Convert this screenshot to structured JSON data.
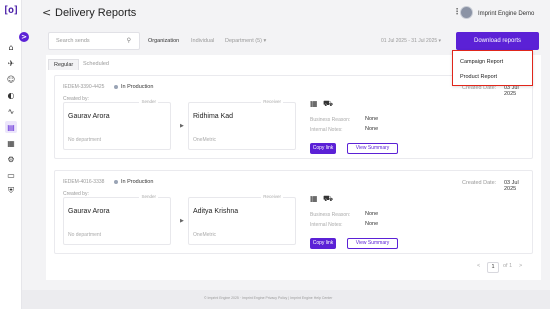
{
  "app": {
    "logo": "[o]",
    "user_name": "Imprint Engine Demo"
  },
  "header": {
    "title": "Delivery Reports",
    "back": "<"
  },
  "sidebar": {
    "collapse": ">",
    "icons": [
      "home-icon",
      "megaphone-icon",
      "people-icon",
      "palette-icon",
      "analytics-icon",
      "reports-icon",
      "grid-icon",
      "settings-icon",
      "wallet-icon",
      "shield-icon"
    ]
  },
  "filters": {
    "search_placeholder": "Search sends",
    "tabs": [
      "Organization",
      "Individual",
      "Department (5) ▾"
    ],
    "date_range": "01 Jul 2025 - 31 Jul 2025 ▾",
    "download_label": "Download reports"
  },
  "sub_tabs": [
    "Regular",
    "Scheduled"
  ],
  "labels": {
    "created_by": "Created by:",
    "sender": "Sender",
    "receiver": "Receiver",
    "created_date": "Created Date:",
    "business_reason": "Business Reason:",
    "internal_notes": "Internal Notes:",
    "copy_link": "Copy link",
    "view_summary": "View Summary"
  },
  "cards": [
    {
      "id": "IEDEM-3390-4425",
      "status": "In Production",
      "date": "03 Jul 2025",
      "sender_name": "Gaurav Arora",
      "sender_dept": "No department",
      "receiver_name": "Ridhima Kad",
      "receiver_org": "OneMetric",
      "business_reason": "None",
      "internal_notes": "None"
    },
    {
      "id": "IEDEM-4016-3338",
      "status": "In Production",
      "date": "03 Jul 2025",
      "sender_name": "Gaurav Arora",
      "sender_dept": "No department",
      "receiver_name": "Aditya Krishna",
      "receiver_org": "OneMetric",
      "business_reason": "None",
      "internal_notes": "None"
    }
  ],
  "pagination": {
    "prev": "<",
    "page": "1",
    "of": "of 1",
    "next": ">"
  },
  "footer": "© Imprint Engine 2025 · Imprint Engine Privacy Policy | Imprint Engine Help Center",
  "dropdown": {
    "items": [
      "Campaign Report",
      "Product Report"
    ],
    "highlight_color": "#e0261b"
  },
  "colors": {
    "accent": "#5b21d6"
  }
}
